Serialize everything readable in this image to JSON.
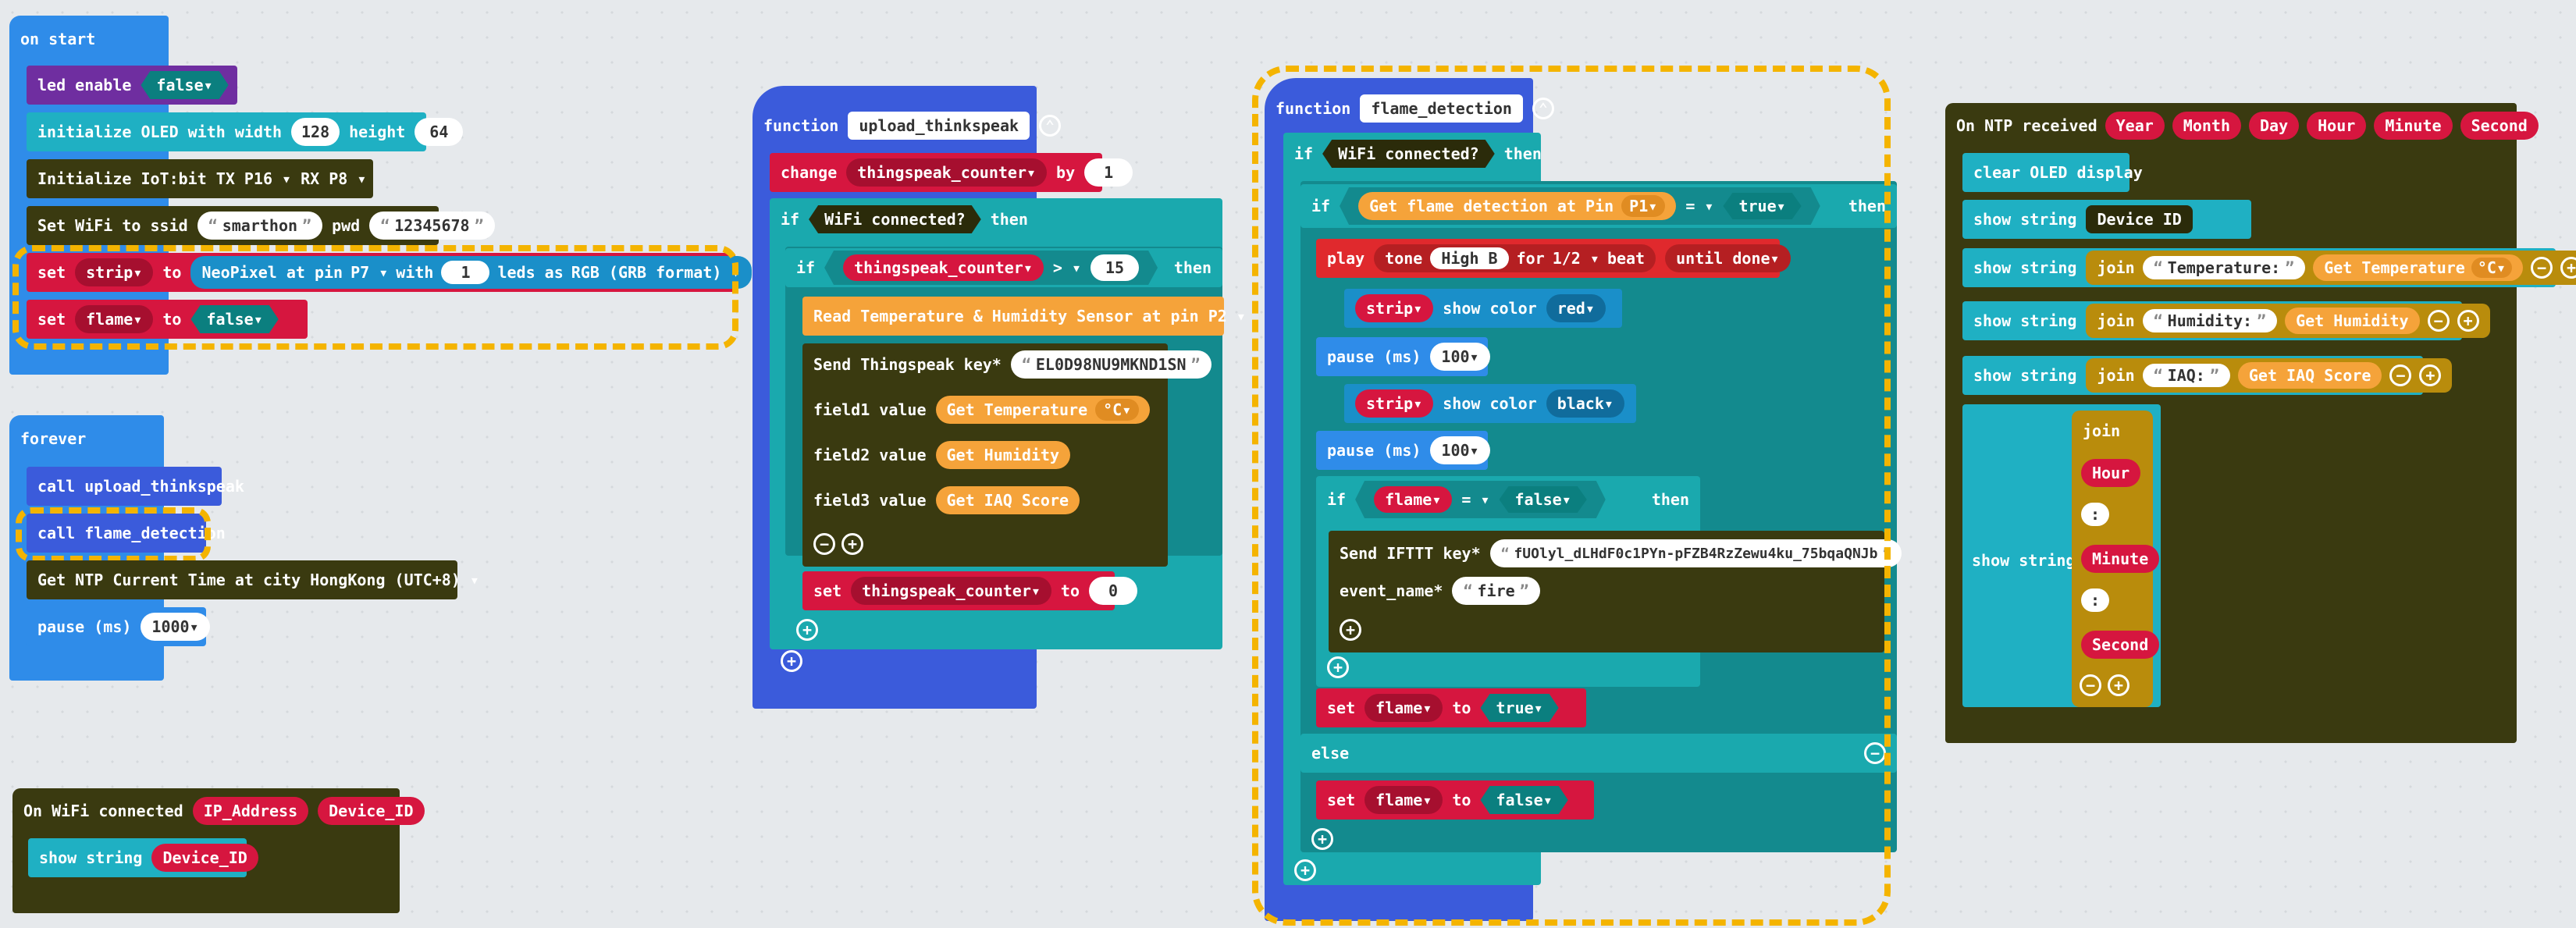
{
  "colors": {
    "base": "#2f8ce9",
    "function": "#3b5bdb",
    "control": "#1aa9ae",
    "iot": "#3a3a10",
    "variables": "#d6163f",
    "neopixel": "#1a8fc9",
    "oled": "#1fb0c3",
    "sensor": "#f5a33a",
    "logic": "#0b7f7f",
    "led": "#6f2ea0",
    "music": "#e0292d",
    "text": "#b98c0c",
    "highlight": "#f4b400"
  },
  "on_start": {
    "hat": "on start",
    "led_enable": "led enable",
    "led_value": "false",
    "oled_init": "initialize OLED with width",
    "oled_width": "128",
    "oled_height_label": "height",
    "oled_height": "64",
    "iot_init": "Initialize IoT:bit TX",
    "tx_pin": "P16",
    "rx_label": "RX",
    "rx_pin": "P8",
    "wifi": "Set WiFi to ssid",
    "ssid": "smarthon",
    "pwd_label": "pwd",
    "pwd": "12345678",
    "set_label": "set",
    "strip_var": "strip",
    "to_label": "to",
    "neo": "NeoPixel at pin",
    "neo_pin": "P7",
    "with_label": "with",
    "leds_count": "1",
    "leds_as": "leds as",
    "format": "RGB (GRB format)",
    "flame_var": "flame",
    "flame_val": "false"
  },
  "forever": {
    "hat": "forever",
    "call1": "call upload_thinkspeak",
    "call2": "call flame_detection",
    "ntp": "Get NTP Current Time at city",
    "city": "HongKong (UTC+8)",
    "pause": "pause (ms)",
    "pause_val": "1000"
  },
  "on_wifi": {
    "hat": "On WiFi connected",
    "param1": "IP_Address",
    "param2": "Device_ID",
    "show": "show string",
    "show_val": "Device_ID"
  },
  "upload_fn": {
    "function_label": "function",
    "name": "upload_thinkspeak",
    "change": "change",
    "counter_var": "thingspeak_counter",
    "by_label": "by",
    "by_val": "1",
    "if_label": "if",
    "wifi_connected": "WiFi connected?",
    "then_label": "then",
    "compare_op": ">",
    "compare_val": "15",
    "read_sensor": "Read Temperature & Humidity Sensor at pin",
    "sensor_pin": "P2",
    "send_key": "Send Thingspeak key*",
    "key_val": "EL0D98NU9MKND1SN",
    "field1": "field1 value",
    "get_temp": "Get Temperature",
    "unit": "°C",
    "field2": "field2 value",
    "get_hum": "Get Humidity",
    "field3": "field3 value",
    "get_iaq": "Get IAQ Score",
    "set_label": "set",
    "to_label": "to",
    "set_val": "0"
  },
  "flame_fn": {
    "function_label": "function",
    "name": "flame_detection",
    "if_label": "if",
    "wifi_connected": "WiFi connected?",
    "then_label": "then",
    "get_flame": "Get flame detection at Pin",
    "flame_pin": "P1",
    "eq": "=",
    "true_val": "true",
    "play": "play",
    "tone": "tone",
    "note": "High B",
    "for_label": "for",
    "beat_val": "1/2",
    "beat": "beat",
    "until": "until done",
    "strip_var": "strip",
    "show_color": "show color",
    "red": "red",
    "black": "black",
    "pause": "pause (ms)",
    "pause_val": "100",
    "flame_var": "flame",
    "false_val": "false",
    "send_ifttt": "Send IFTTT key*",
    "ifttt_key": "fUOlyl_dLHdF0c1PYn-pFZB4RzZewu4ku_75bqaQNJb",
    "event_name": "event_name*",
    "event_val": "fire",
    "set_label": "set",
    "to_label": "to",
    "else_label": "else"
  },
  "ntp_block": {
    "hat": "On NTP received",
    "params": [
      "Year",
      "Month",
      "Day",
      "Hour",
      "Minute",
      "Second"
    ],
    "clear": "clear OLED display",
    "show": "show string",
    "device_id": "Device ID",
    "join": "join",
    "temp_label": "Temperature: ",
    "get_temp": "Get Temperature",
    "unit": "°C",
    "hum_label": "Humidity: ",
    "get_hum": "Get Humidity",
    "iaq_label": "IAQ: ",
    "get_iaq": "Get IAQ Score",
    "hour": "Hour",
    "colon": ":",
    "minute": "Minute",
    "second": "Second"
  }
}
